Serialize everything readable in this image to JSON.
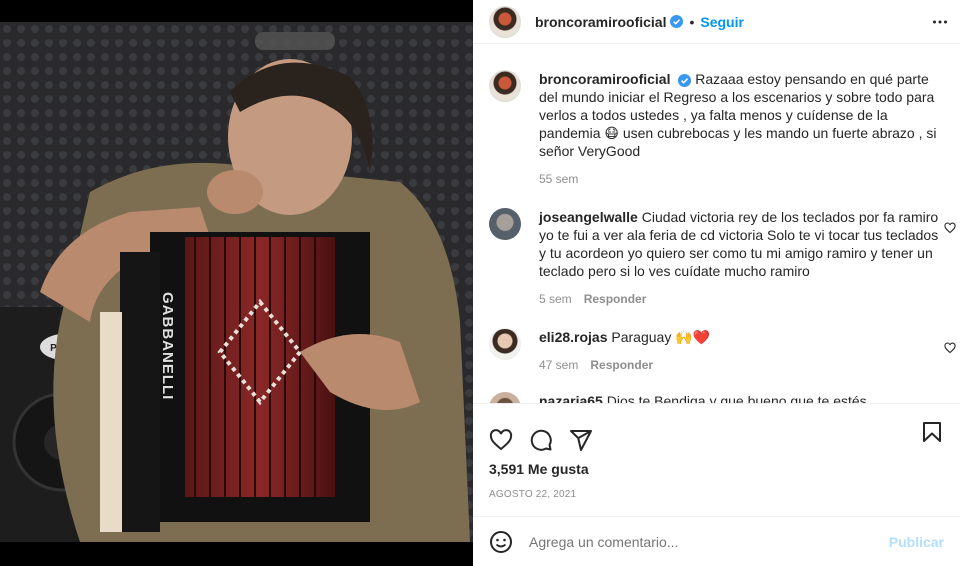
{
  "post": {
    "username": "broncoramirooficial",
    "follow_label": "Seguir",
    "separator": "•"
  },
  "caption": {
    "username": "broncoramirooficial",
    "text": "Razaaa estoy pensando en qué parte del mundo iniciar el Regreso a los escenarios y sobre todo para verlos a todos ustedes , ya falta menos y cuídense de la pandemia 😷 usen cubrebocas y les mando un fuerte abrazo , si señor VeryGood",
    "time": "55 sem"
  },
  "comments": [
    {
      "username": "joseangelwalle",
      "text": "Ciudad victoria rey de los teclados por fa ramiro yo te fui a ver ala feria de cd victoria Solo te vi tocar tus teclados y tu acordeon yo quiero ser como tu mi amigo ramiro y tener un teclado pero si lo ves cuídate mucho ramiro",
      "time": "5 sem",
      "reply": "Responder"
    },
    {
      "username": "eli28.rojas",
      "text": "Paraguay 🙌❤️",
      "time": "47 sem",
      "reply": "Responder"
    },
    {
      "username": "nazaria65",
      "text": "Dios te Bendiga y que bueno que te estés",
      "time": "",
      "reply": ""
    }
  ],
  "actions": {
    "likes": "3,591 Me gusta",
    "date": "AGOSTO 22, 2021"
  },
  "add_comment": {
    "placeholder": "Agrega un comentario...",
    "post_label": "Publicar"
  },
  "colors": {
    "accent": "#0095f6",
    "muted": "#8e8e8e",
    "post_disabled": "#b2dffc"
  },
  "media": {
    "speaker_brand": "PEAVEY",
    "accordion_brand": "GABBANELLI"
  }
}
